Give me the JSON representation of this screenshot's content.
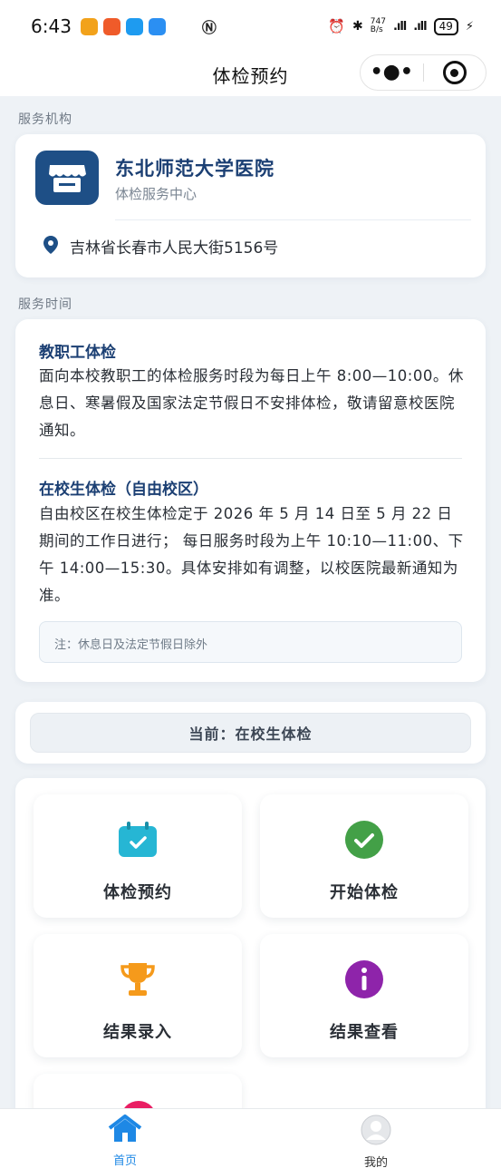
{
  "status_bar": {
    "time": "6:43",
    "net_speed": "747\nB/s",
    "battery": "49"
  },
  "nav": {
    "title": "体检预约",
    "more_glyph": "•●•"
  },
  "org_section": {
    "label": "服务机构"
  },
  "org": {
    "name": "东北师范大学医院",
    "subtitle": "体检服务中心",
    "address": "吉林省长春市人民大街5156号"
  },
  "time_section": {
    "label": "服务时间"
  },
  "staff": {
    "title": "教职工体检",
    "body": "面向本校教职工的体检服务时段为每日上午 8:00—10:00。休息日、寒暑假及国家法定节假日不安排体检，敬请留意校医院通知。"
  },
  "student": {
    "title": "在校生体检（自由校区）",
    "body": "自由校区在校生体检定于 2026 年 5 月 14 日至 5 月 22 日期间的工作日进行； 每日服务时段为上午 10:10—11:00、下午 14:00—15:30。具体安排如有调整，以校医院最新通知为准。",
    "note": "注：休息日及法定节假日除外"
  },
  "current": {
    "text": "当前：在校生体检"
  },
  "menu": {
    "items": [
      {
        "label": "体检预约",
        "icon": "calendar-icon",
        "color": "#26b6d4"
      },
      {
        "label": "开始体检",
        "icon": "check-circle-icon",
        "color": "#43a047"
      },
      {
        "label": "结果录入",
        "icon": "trophy-icon",
        "color": "#f59a1b"
      },
      {
        "label": "结果查看",
        "icon": "info-icon",
        "color": "#8e24aa"
      }
    ]
  },
  "tabbar": {
    "tabs": [
      {
        "label": "首页",
        "icon": "home-icon",
        "active": true,
        "color": "#1e88e5"
      },
      {
        "label": "我的",
        "icon": "user-icon",
        "active": false,
        "color": "#333333"
      }
    ]
  }
}
